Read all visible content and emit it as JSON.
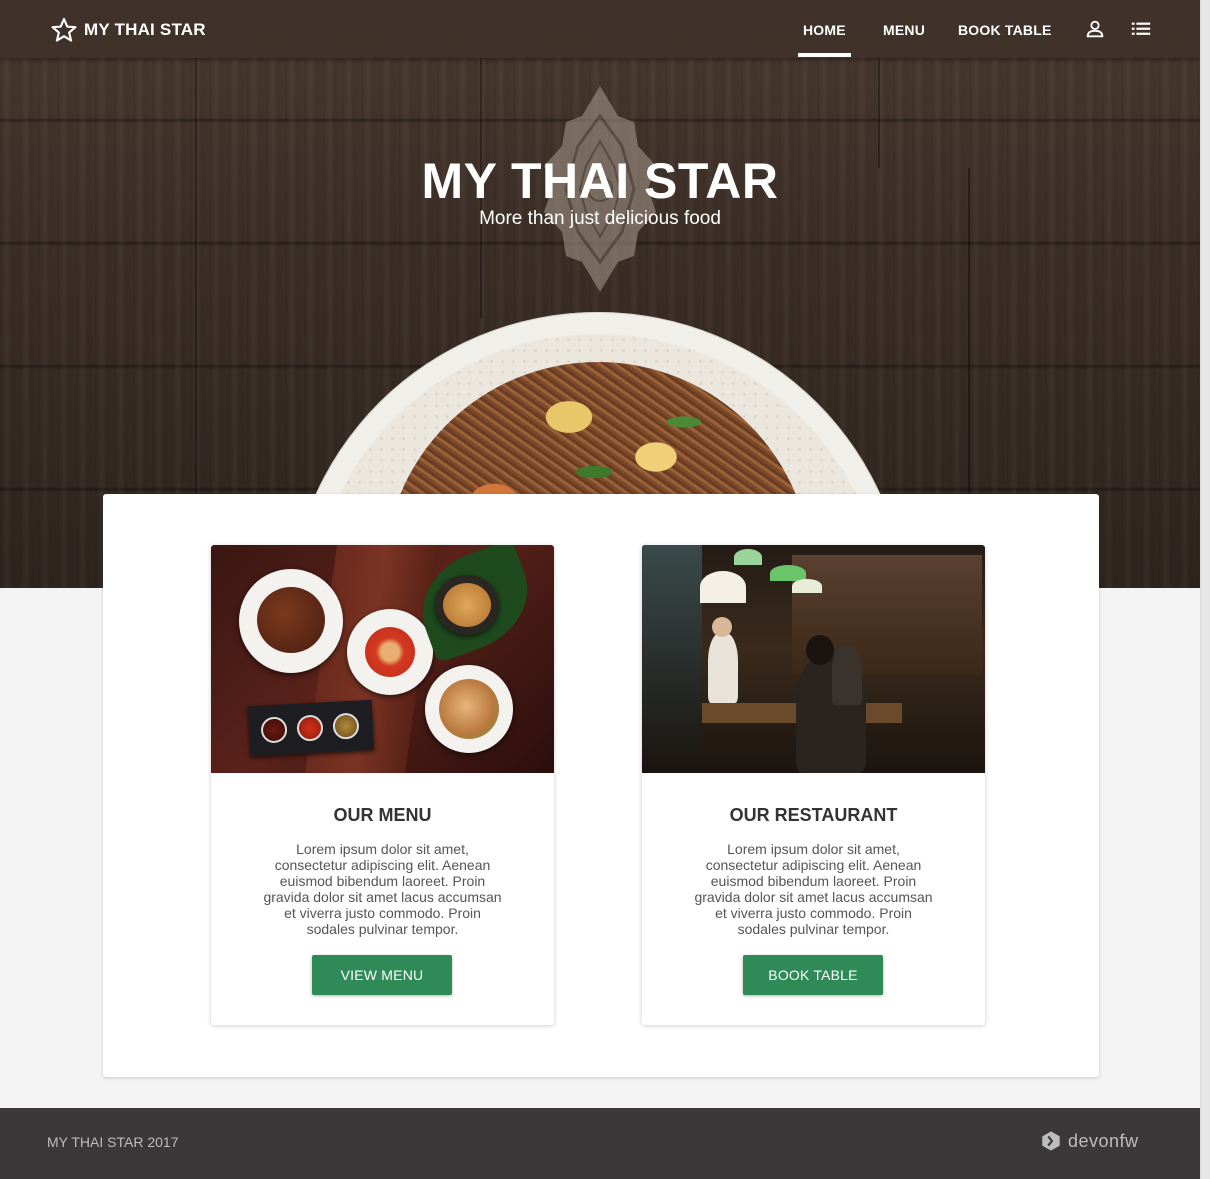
{
  "brand": {
    "name": "MY THAI STAR",
    "icon": "star-outline-icon"
  },
  "nav": {
    "items": [
      {
        "label": "HOME",
        "active": true
      },
      {
        "label": "MENU",
        "active": false
      },
      {
        "label": "BOOK TABLE",
        "active": false
      }
    ],
    "icons": [
      "user-icon",
      "list-icon"
    ]
  },
  "hero": {
    "title": "MY THAI STAR",
    "subtitle": "More than just delicious food"
  },
  "features": [
    {
      "title": "OUR MENU",
      "text": "Lorem ipsum dolor sit amet, consectetur adipiscing elit. Aenean euismod bibendum laoreet. Proin gravida dolor sit amet lacus accumsan et viverra justo commodo. Proin sodales pulvinar tempor.",
      "button": "VIEW MENU"
    },
    {
      "title": "OUR RESTAURANT",
      "text": "Lorem ipsum dolor sit amet, consectetur adipiscing elit. Aenean euismod bibendum laoreet. Proin gravida dolor sit amet lacus accumsan et viverra justo commodo. Proin sodales pulvinar tempor.",
      "button": "BOOK TABLE"
    }
  ],
  "footer": {
    "copyright": "MY THAI STAR 2017",
    "logo_text": "devonfw"
  },
  "colors": {
    "accent": "#2e8b57",
    "footer": "#3a3838",
    "navbar": "#40322a"
  }
}
